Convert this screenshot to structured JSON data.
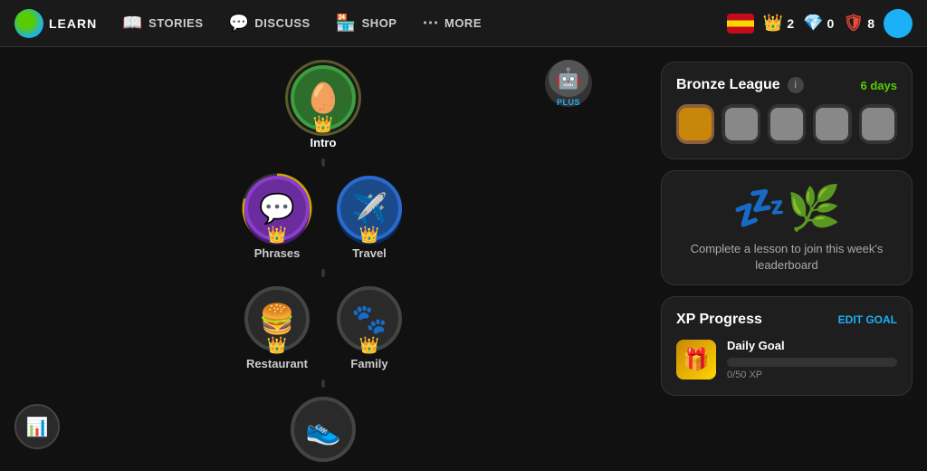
{
  "nav": {
    "logo_label": "LEARN",
    "items": [
      {
        "id": "learn",
        "label": "LEARN",
        "icon": "🦉",
        "active": true
      },
      {
        "id": "stories",
        "label": "STORIES",
        "icon": "📖"
      },
      {
        "id": "discuss",
        "label": "DISCUSS",
        "icon": "💬"
      },
      {
        "id": "shop",
        "label": "SHOP",
        "icon": "🏪"
      },
      {
        "id": "more",
        "label": "MORE",
        "icon": "•••"
      }
    ],
    "stats": {
      "crowns": "2",
      "gems": "0",
      "shields": "8"
    }
  },
  "skill_tree": {
    "plus_label": "PLUS",
    "nodes": [
      {
        "id": "intro",
        "label": "Intro",
        "emoji": "🥚",
        "has_crown": true,
        "style": "intro"
      },
      {
        "id": "phrases",
        "label": "Phrases",
        "emoji": "💬",
        "has_crown": true,
        "style": "phrases"
      },
      {
        "id": "travel",
        "label": "Travel",
        "emoji": "✈️",
        "has_crown": true,
        "style": "travel"
      },
      {
        "id": "restaurant",
        "label": "Restaurant",
        "emoji": "🍔",
        "has_crown": true,
        "style": "restaurant"
      },
      {
        "id": "family",
        "label": "Family",
        "emoji": "🐾",
        "has_crown": true,
        "style": "family"
      },
      {
        "id": "bottom",
        "label": "",
        "emoji": "👟",
        "has_crown": false,
        "style": "bottom"
      }
    ]
  },
  "bronze_league": {
    "title": "Bronze League",
    "days_label": "6 days"
  },
  "leaderboard": {
    "sleep_text": "Complete a lesson to join this week's leaderboard"
  },
  "xp_progress": {
    "title": "XP Progress",
    "edit_label": "EDIT GOAL",
    "daily_goal_label": "Daily Goal",
    "xp_count": "0/50 XP",
    "fill_percent": 0
  }
}
